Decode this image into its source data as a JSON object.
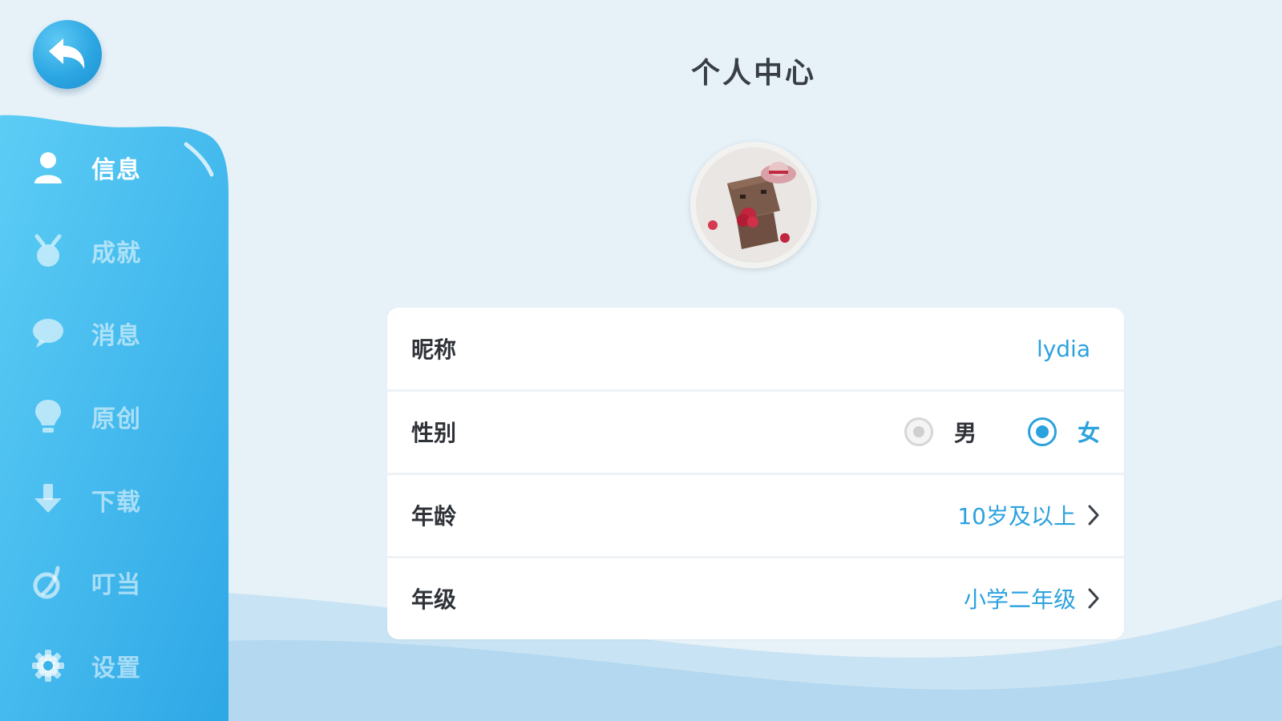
{
  "colors": {
    "accent": "#2ba2de",
    "sidebar": "#3bb4ea",
    "background": "#e6f1f8"
  },
  "header": {
    "title": "个人中心",
    "back_icon": "back-arrow-icon"
  },
  "sidebar": {
    "items": [
      {
        "label": "信息",
        "icon": "person-icon",
        "active": true
      },
      {
        "label": "成就",
        "icon": "medal-icon",
        "active": false
      },
      {
        "label": "消息",
        "icon": "chat-bubble-icon",
        "active": false
      },
      {
        "label": "原创",
        "icon": "lightbulb-icon",
        "active": false
      },
      {
        "label": "下载",
        "icon": "download-icon",
        "active": false
      },
      {
        "label": "叮当",
        "icon": "dingdang-icon",
        "active": false
      },
      {
        "label": "设置",
        "icon": "gear-icon",
        "active": false
      }
    ]
  },
  "profile": {
    "nickname": {
      "label": "昵称",
      "value": "lydia"
    },
    "gender": {
      "label": "性别",
      "options": [
        "男",
        "女"
      ],
      "selected": "女"
    },
    "age": {
      "label": "年龄",
      "value": "10岁及以上"
    },
    "grade": {
      "label": "年级",
      "value": "小学二年级"
    }
  }
}
